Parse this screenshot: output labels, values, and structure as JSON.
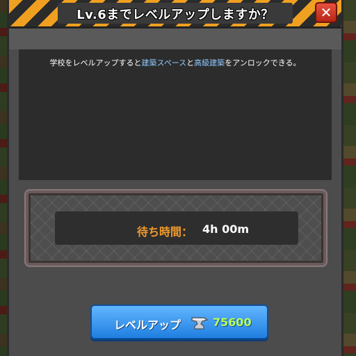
{
  "dialog": {
    "title": "Lv.6までレベルアップしますか？",
    "close_symbol": "✕"
  },
  "description": {
    "part1": "学校をレベルアップすると",
    "highlight1": "建築スペース",
    "part2": "と",
    "highlight2": "高級建築",
    "part3": "をアンロックできる。"
  },
  "wait": {
    "label": "待ち時間：",
    "value": "4h 00m"
  },
  "level_up_button": {
    "label": "レベルアップ",
    "icon": "anvil-icon",
    "cost": "75600"
  },
  "colors": {
    "title_stripe": "#f0a020",
    "close_button": "#d9432f",
    "highlight_text": "#8ec8ff",
    "wait_label": "#f29a2c",
    "button_blue": "#3a9aff",
    "cost_green": "#b8ff5a"
  }
}
